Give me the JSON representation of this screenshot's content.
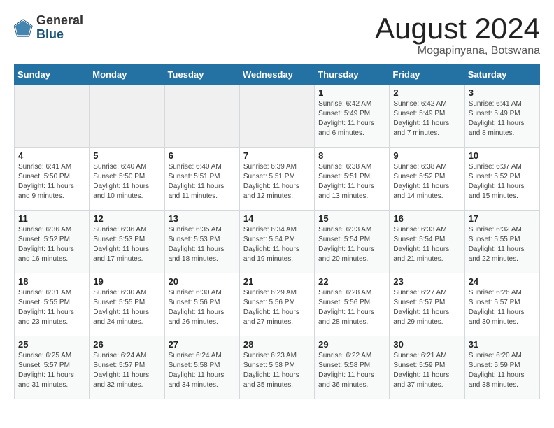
{
  "logo": {
    "general": "General",
    "blue": "Blue"
  },
  "title": "August 2024",
  "location": "Mogapinyana, Botswana",
  "days_of_week": [
    "Sunday",
    "Monday",
    "Tuesday",
    "Wednesday",
    "Thursday",
    "Friday",
    "Saturday"
  ],
  "weeks": [
    [
      {
        "day": "",
        "info": ""
      },
      {
        "day": "",
        "info": ""
      },
      {
        "day": "",
        "info": ""
      },
      {
        "day": "",
        "info": ""
      },
      {
        "day": "1",
        "info": "Sunrise: 6:42 AM\nSunset: 5:49 PM\nDaylight: 11 hours and 6 minutes."
      },
      {
        "day": "2",
        "info": "Sunrise: 6:42 AM\nSunset: 5:49 PM\nDaylight: 11 hours and 7 minutes."
      },
      {
        "day": "3",
        "info": "Sunrise: 6:41 AM\nSunset: 5:49 PM\nDaylight: 11 hours and 8 minutes."
      }
    ],
    [
      {
        "day": "4",
        "info": "Sunrise: 6:41 AM\nSunset: 5:50 PM\nDaylight: 11 hours and 9 minutes."
      },
      {
        "day": "5",
        "info": "Sunrise: 6:40 AM\nSunset: 5:50 PM\nDaylight: 11 hours and 10 minutes."
      },
      {
        "day": "6",
        "info": "Sunrise: 6:40 AM\nSunset: 5:51 PM\nDaylight: 11 hours and 11 minutes."
      },
      {
        "day": "7",
        "info": "Sunrise: 6:39 AM\nSunset: 5:51 PM\nDaylight: 11 hours and 12 minutes."
      },
      {
        "day": "8",
        "info": "Sunrise: 6:38 AM\nSunset: 5:51 PM\nDaylight: 11 hours and 13 minutes."
      },
      {
        "day": "9",
        "info": "Sunrise: 6:38 AM\nSunset: 5:52 PM\nDaylight: 11 hours and 14 minutes."
      },
      {
        "day": "10",
        "info": "Sunrise: 6:37 AM\nSunset: 5:52 PM\nDaylight: 11 hours and 15 minutes."
      }
    ],
    [
      {
        "day": "11",
        "info": "Sunrise: 6:36 AM\nSunset: 5:52 PM\nDaylight: 11 hours and 16 minutes."
      },
      {
        "day": "12",
        "info": "Sunrise: 6:36 AM\nSunset: 5:53 PM\nDaylight: 11 hours and 17 minutes."
      },
      {
        "day": "13",
        "info": "Sunrise: 6:35 AM\nSunset: 5:53 PM\nDaylight: 11 hours and 18 minutes."
      },
      {
        "day": "14",
        "info": "Sunrise: 6:34 AM\nSunset: 5:54 PM\nDaylight: 11 hours and 19 minutes."
      },
      {
        "day": "15",
        "info": "Sunrise: 6:33 AM\nSunset: 5:54 PM\nDaylight: 11 hours and 20 minutes."
      },
      {
        "day": "16",
        "info": "Sunrise: 6:33 AM\nSunset: 5:54 PM\nDaylight: 11 hours and 21 minutes."
      },
      {
        "day": "17",
        "info": "Sunrise: 6:32 AM\nSunset: 5:55 PM\nDaylight: 11 hours and 22 minutes."
      }
    ],
    [
      {
        "day": "18",
        "info": "Sunrise: 6:31 AM\nSunset: 5:55 PM\nDaylight: 11 hours and 23 minutes."
      },
      {
        "day": "19",
        "info": "Sunrise: 6:30 AM\nSunset: 5:55 PM\nDaylight: 11 hours and 24 minutes."
      },
      {
        "day": "20",
        "info": "Sunrise: 6:30 AM\nSunset: 5:56 PM\nDaylight: 11 hours and 26 minutes."
      },
      {
        "day": "21",
        "info": "Sunrise: 6:29 AM\nSunset: 5:56 PM\nDaylight: 11 hours and 27 minutes."
      },
      {
        "day": "22",
        "info": "Sunrise: 6:28 AM\nSunset: 5:56 PM\nDaylight: 11 hours and 28 minutes."
      },
      {
        "day": "23",
        "info": "Sunrise: 6:27 AM\nSunset: 5:57 PM\nDaylight: 11 hours and 29 minutes."
      },
      {
        "day": "24",
        "info": "Sunrise: 6:26 AM\nSunset: 5:57 PM\nDaylight: 11 hours and 30 minutes."
      }
    ],
    [
      {
        "day": "25",
        "info": "Sunrise: 6:25 AM\nSunset: 5:57 PM\nDaylight: 11 hours and 31 minutes."
      },
      {
        "day": "26",
        "info": "Sunrise: 6:24 AM\nSunset: 5:57 PM\nDaylight: 11 hours and 32 minutes."
      },
      {
        "day": "27",
        "info": "Sunrise: 6:24 AM\nSunset: 5:58 PM\nDaylight: 11 hours and 34 minutes."
      },
      {
        "day": "28",
        "info": "Sunrise: 6:23 AM\nSunset: 5:58 PM\nDaylight: 11 hours and 35 minutes."
      },
      {
        "day": "29",
        "info": "Sunrise: 6:22 AM\nSunset: 5:58 PM\nDaylight: 11 hours and 36 minutes."
      },
      {
        "day": "30",
        "info": "Sunrise: 6:21 AM\nSunset: 5:59 PM\nDaylight: 11 hours and 37 minutes."
      },
      {
        "day": "31",
        "info": "Sunrise: 6:20 AM\nSunset: 5:59 PM\nDaylight: 11 hours and 38 minutes."
      }
    ]
  ]
}
